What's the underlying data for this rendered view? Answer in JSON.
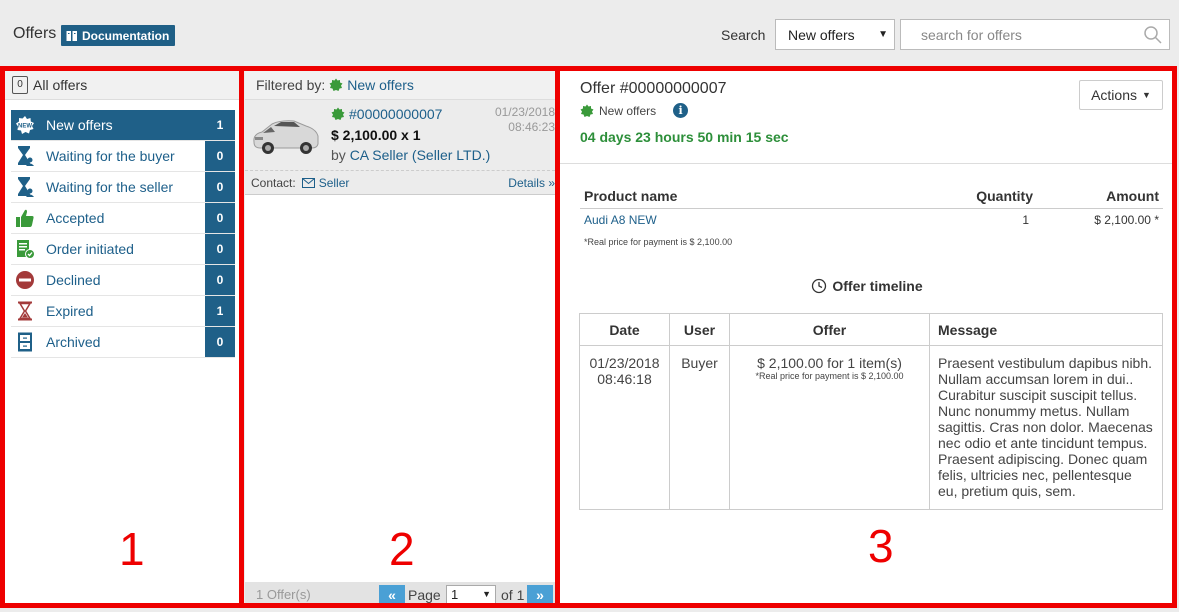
{
  "header": {
    "title": "Offers",
    "doc_label": "Documentation",
    "search_label": "Search",
    "search_select": "New offers",
    "search_placeholder": "search for offers"
  },
  "sidebar": {
    "all_offers": "All offers",
    "all_offers_badge": "0",
    "items": [
      {
        "label": "New offers",
        "count": "1",
        "icon": "new-badge-icon"
      },
      {
        "label": "Waiting for the buyer",
        "count": "0",
        "icon": "hourglass-person-icon"
      },
      {
        "label": "Waiting for the seller",
        "count": "0",
        "icon": "hourglass-person-icon"
      },
      {
        "label": "Accepted",
        "count": "0",
        "icon": "thumbs-up-icon"
      },
      {
        "label": "Order initiated",
        "count": "0",
        "icon": "order-doc-icon"
      },
      {
        "label": "Declined",
        "count": "0",
        "icon": "no-entry-icon"
      },
      {
        "label": "Expired",
        "count": "1",
        "icon": "hourglass-icon"
      },
      {
        "label": "Archived",
        "count": "0",
        "icon": "cabinet-icon"
      }
    ]
  },
  "list": {
    "filtered_by": "Filtered by:",
    "filter_value": "New offers",
    "offer": {
      "number": "#00000000007",
      "price": "$ 2,100.00 x 1",
      "by": "by",
      "seller": "CA Seller (Seller LTD.)",
      "date": "01/23/2018",
      "time": "08:46:23",
      "contact": "Contact:",
      "contact_link": "Seller",
      "details": "Details"
    },
    "footer": {
      "count": "1 Offer(s)",
      "page_label": "Page",
      "page_value": "1",
      "of": "of 1"
    }
  },
  "detail": {
    "title": "Offer #00000000007",
    "status": "New offers",
    "timer": "04 days 23 hours 50 min 15 sec",
    "actions": "Actions",
    "products": {
      "headers": [
        "Product name",
        "Quantity",
        "Amount"
      ],
      "rows": [
        {
          "name": "Audi A8 NEW",
          "qty": "1",
          "amount": "$ 2,100.00 *"
        }
      ],
      "note": "*Real price for payment is $ 2,100.00"
    },
    "timeline": {
      "title": "Offer timeline",
      "headers": [
        "Date",
        "User",
        "Offer",
        "Message"
      ],
      "row": {
        "date": "01/23/2018",
        "time": "08:46:18",
        "user": "Buyer",
        "offer": "$ 2,100.00 for 1 item(s)",
        "offer_note": "*Real price for payment is $ 2,100.00",
        "message": "Praesent vestibulum dapibus nibh. Nullam accumsan lorem in dui.. Curabitur suscipit suscipit tellus. Nunc nonummy metus. Nullam sagittis. Cras non dolor. Maecenas nec odio et ante tincidunt tempus. Praesent adipiscing. Donec quam felis, ultricies nec, pellentesque eu, pretium quis, sem."
      }
    }
  },
  "annotations": {
    "one": "1",
    "two": "2",
    "three": "3"
  },
  "colors": {
    "accent": "#1f6088",
    "link": "#1d5f8a",
    "timer": "#2d8f3a",
    "highlight": "#ee0000"
  }
}
